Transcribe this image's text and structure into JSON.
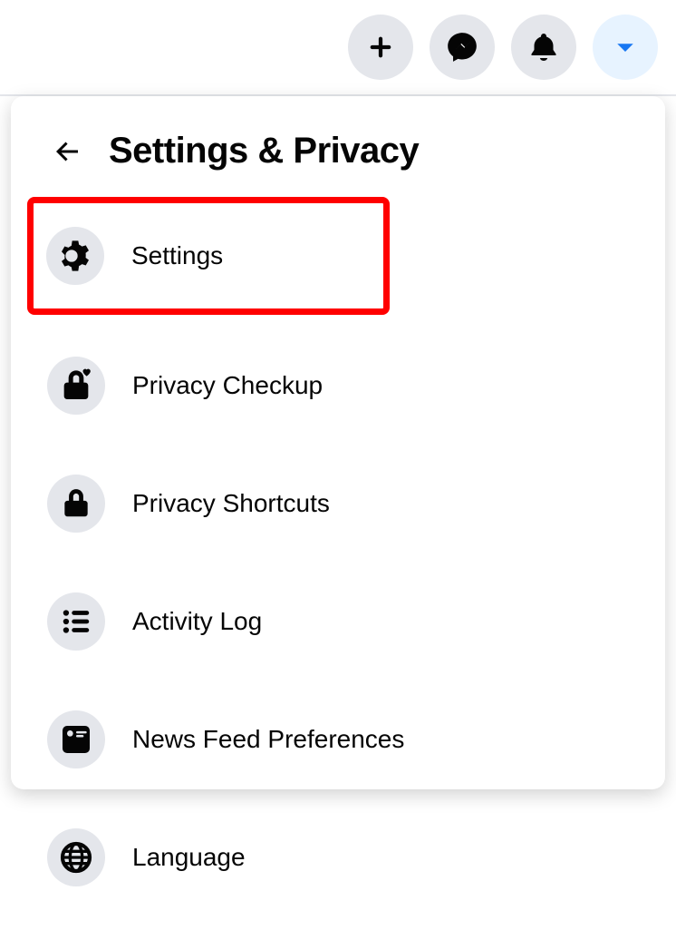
{
  "header": {
    "title": "Settings & Privacy"
  },
  "menu": {
    "items": [
      {
        "label": "Settings",
        "icon": "gear",
        "highlight": true
      },
      {
        "label": "Privacy Checkup",
        "icon": "lock-heart",
        "highlight": false
      },
      {
        "label": "Privacy Shortcuts",
        "icon": "lock",
        "highlight": false
      },
      {
        "label": "Activity Log",
        "icon": "list",
        "highlight": false
      },
      {
        "label": "News Feed Preferences",
        "icon": "feed",
        "highlight": false
      },
      {
        "label": "Language",
        "icon": "globe",
        "highlight": false
      }
    ]
  },
  "topbar": {
    "buttons": [
      "create",
      "messenger",
      "notifications",
      "account"
    ]
  },
  "colors": {
    "iconBg": "#e4e6eb",
    "activeBg": "#e7f3ff",
    "activeFg": "#1877f2",
    "highlightBorder": "#ff0000"
  }
}
